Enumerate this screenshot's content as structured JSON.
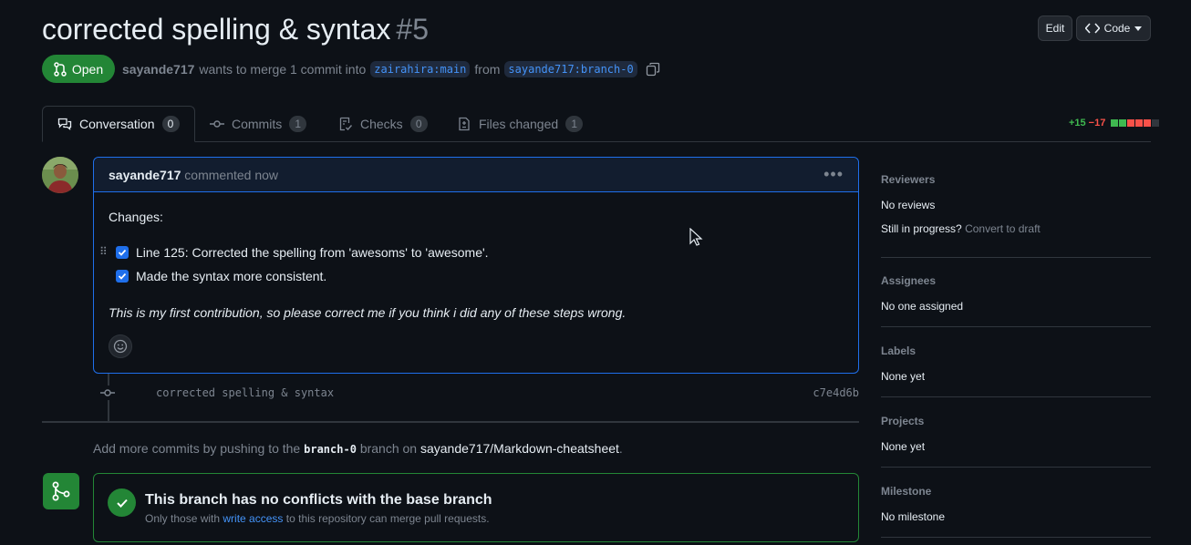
{
  "pr": {
    "title": "corrected spelling & syntax",
    "number": "#5",
    "state": "Open",
    "author": "sayande717",
    "merge_text_1": "wants to merge 1 commit into",
    "base_branch": "zairahira:main",
    "merge_text_2": "from",
    "head_branch": "sayande717:branch-0"
  },
  "header_buttons": {
    "edit": "Edit",
    "code": "Code"
  },
  "tabs": [
    {
      "label": "Conversation",
      "count": "0"
    },
    {
      "label": "Commits",
      "count": "1"
    },
    {
      "label": "Checks",
      "count": "0"
    },
    {
      "label": "Files changed",
      "count": "1"
    }
  ],
  "diffstat": {
    "additions": "+15",
    "deletions": "−17",
    "blocks": [
      "#3fb950",
      "#3fb950",
      "#f85149",
      "#f85149",
      "#f85149",
      "#30363d"
    ]
  },
  "comment": {
    "author": "sayande717",
    "time": "commented now",
    "heading": "Changes:",
    "tasks": [
      "Line 125: Corrected the spelling from 'awesoms' to 'awesome'.",
      "Made the syntax more consistent."
    ],
    "note": "This is my first contribution, so please correct me if you think i did any of these steps wrong."
  },
  "commit": {
    "message": "corrected spelling & syntax",
    "sha": "c7e4d6b"
  },
  "hint": {
    "prefix": "Add more commits by pushing to the",
    "branch": "branch-0",
    "middle": "branch on",
    "repo": "sayande717/Markdown-cheatsheet",
    "suffix": "."
  },
  "merge": {
    "title": "This branch has no conflicts with the base branch",
    "sub_prefix": "Only those with",
    "sub_link": "write access",
    "sub_suffix": "to this repository can merge pull requests."
  },
  "sidebar": {
    "reviewers": {
      "heading": "Reviewers",
      "value": "No reviews",
      "progress": "Still in progress?",
      "draft_link": "Convert to draft"
    },
    "assignees": {
      "heading": "Assignees",
      "value": "No one assigned"
    },
    "labels": {
      "heading": "Labels",
      "value": "None yet"
    },
    "projects": {
      "heading": "Projects",
      "value": "None yet"
    },
    "milestone": {
      "heading": "Milestone",
      "value": "No milestone"
    }
  },
  "colors": {
    "accent": "#1f6feb",
    "success": "#238636",
    "link": "#4493f8",
    "background": "#0d1117"
  }
}
